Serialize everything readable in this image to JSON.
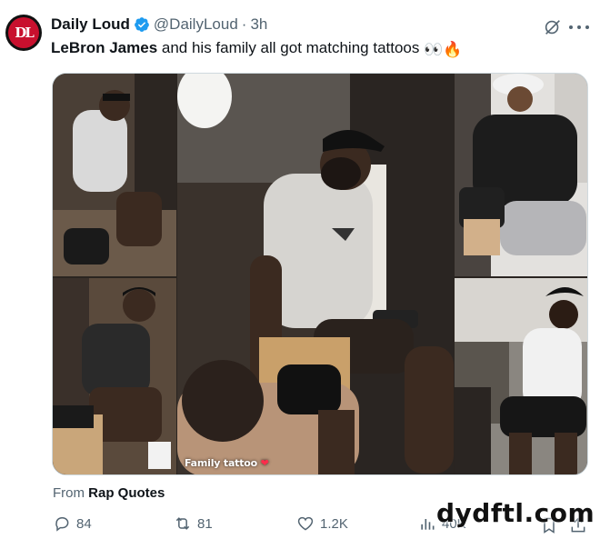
{
  "tweet": {
    "display_name": "Daily Loud",
    "handle": "@DailyLoud",
    "separator": "·",
    "time": "3h",
    "text_bold": "LeBron James",
    "text_rest": " and his family all got matching tattoos ",
    "emojis": "👀🔥",
    "media_caption": "Family tattoo",
    "source_prefix": "From ",
    "source_name": "Rap Quotes"
  },
  "actions": {
    "replies": "84",
    "reposts": "81",
    "likes": "1.2K",
    "views": "40K"
  },
  "watermark": "dydftl.com",
  "icons": [
    "avatar-logo",
    "verified-badge-icon",
    "grok-icon",
    "more-icon",
    "reply-icon",
    "repost-icon",
    "like-icon",
    "views-icon",
    "bookmark-icon",
    "share-icon"
  ],
  "colors": {
    "verified": "#1d9bf0",
    "muted": "#536471",
    "text": "#0f1419",
    "avatar_red": "#c8102e"
  }
}
